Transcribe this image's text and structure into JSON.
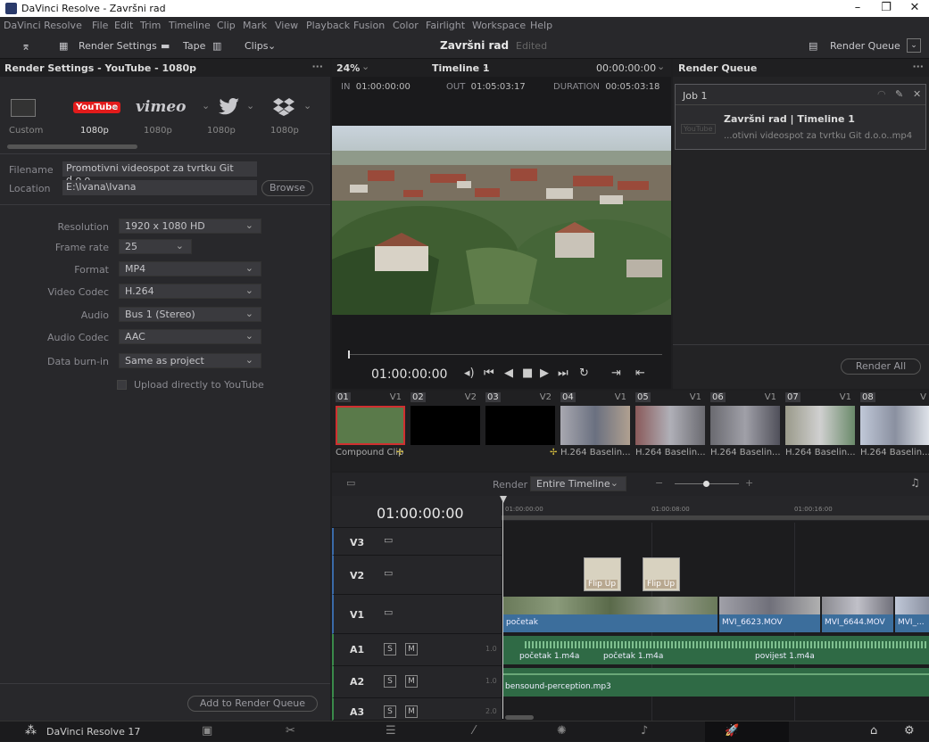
{
  "window": {
    "title": "DaVinci Resolve - Završni rad",
    "minimize": "–",
    "maximize": "❐",
    "close": "✕"
  },
  "menu": [
    "DaVinci Resolve",
    "File",
    "Edit",
    "Trim",
    "Timeline",
    "Clip",
    "Mark",
    "View",
    "Playback",
    "Fusion",
    "Color",
    "Fairlight",
    "Workspace",
    "Help"
  ],
  "toolbar": {
    "render_settings": "Render Settings",
    "tape": "Tape",
    "clips": "Clips",
    "project_name": "Završni rad",
    "status": "Edited",
    "render_queue": "Render Queue"
  },
  "render_settings": {
    "header": "Render Settings - YouTube - 1080p",
    "presets": [
      {
        "name": "Custom",
        "res": ""
      },
      {
        "name": "YouTube",
        "res": "1080p"
      },
      {
        "name": "vimeo",
        "res": "1080p"
      },
      {
        "name": "twitter",
        "res": "1080p"
      },
      {
        "name": "dropbox",
        "res": "1080p"
      }
    ],
    "custom_label": "Custom",
    "filename_label": "Filename",
    "filename_value": "Promotivni videospot za tvrtku Git d.o.o.",
    "location_label": "Location",
    "location_value": "E:\\Ivana\\Ivana",
    "browse": "Browse",
    "fields": [
      {
        "label": "Resolution",
        "value": "1920 x 1080 HD"
      },
      {
        "label": "Frame rate",
        "value": "25"
      },
      {
        "label": "Format",
        "value": "MP4"
      },
      {
        "label": "Video Codec",
        "value": "H.264"
      },
      {
        "label": "Audio",
        "value": "Bus 1 (Stereo)"
      },
      {
        "label": "Audio Codec",
        "value": "AAC"
      },
      {
        "label": "Data burn-in",
        "value": "Same as project"
      }
    ],
    "upload_label": "Upload directly to YouTube",
    "add_button": "Add to Render Queue"
  },
  "viewer": {
    "zoom": "24%",
    "timeline_name": "Timeline 1",
    "timecode_top": "00:00:00:00",
    "in_label": "IN",
    "in_tc": "01:00:00:00",
    "out_label": "OUT",
    "out_tc": "01:05:03:17",
    "duration_label": "DURATION",
    "duration_tc": "00:05:03:18",
    "playhead_tc": "01:00:00:00"
  },
  "render_queue": {
    "header": "Render Queue",
    "job_title": "Job 1",
    "job_name": "Završni rad | Timeline 1",
    "job_file": "...otivni videospot za tvrtku Git d.o.o..mp4",
    "job_badge": "YouTube",
    "render_all": "Render All"
  },
  "clips": [
    {
      "num": "01",
      "track": "V1",
      "caption": "Compound Clip",
      "color": "#5a7a4a"
    },
    {
      "num": "02",
      "track": "V2",
      "caption": "",
      "color": "#000000"
    },
    {
      "num": "03",
      "track": "V2",
      "caption": "",
      "color": "#000000"
    },
    {
      "num": "04",
      "track": "V1",
      "caption": "H.264 Baselin...",
      "color": "#8a8f9a"
    },
    {
      "num": "05",
      "track": "V1",
      "caption": "H.264 Baselin...",
      "color": "#8a6a6a"
    },
    {
      "num": "06",
      "track": "V1",
      "caption": "H.264 Baselin...",
      "color": "#7a7a80"
    },
    {
      "num": "07",
      "track": "V1",
      "caption": "H.264 Baselin...",
      "color": "#8a8a7a"
    },
    {
      "num": "08",
      "track": "V",
      "caption": "H.264 Baselin...",
      "color": "#9aa0b0"
    }
  ],
  "timeline": {
    "render_label": "Render",
    "render_value": "Entire Timeline",
    "timecode": "01:00:00:00",
    "ruler": [
      "01:00:00:00",
      "01:00:08:00",
      "01:00:16:00"
    ],
    "tracks": [
      {
        "name": "V3"
      },
      {
        "name": "V2"
      },
      {
        "name": "V1"
      },
      {
        "name": "A1"
      },
      {
        "name": "A2"
      },
      {
        "name": "A3"
      }
    ],
    "solo": "S",
    "mute": "M",
    "gain_a1": "1.0",
    "gain_a2": "1.0",
    "gain_a3": "2.0",
    "v2_clips": [
      "Flip Up",
      "Flip Up"
    ],
    "v1_clips": [
      "početak",
      "MVI_6623.MOV",
      "MVI_6644.MOV",
      "MVI_..."
    ],
    "a1_clips": [
      "početak 1.m4a",
      "početak 1.m4a",
      "povijest 1.m4a"
    ],
    "a2_clip": "bensound-perception.mp3"
  },
  "bottombar": {
    "app": "DaVinci Resolve 17"
  }
}
